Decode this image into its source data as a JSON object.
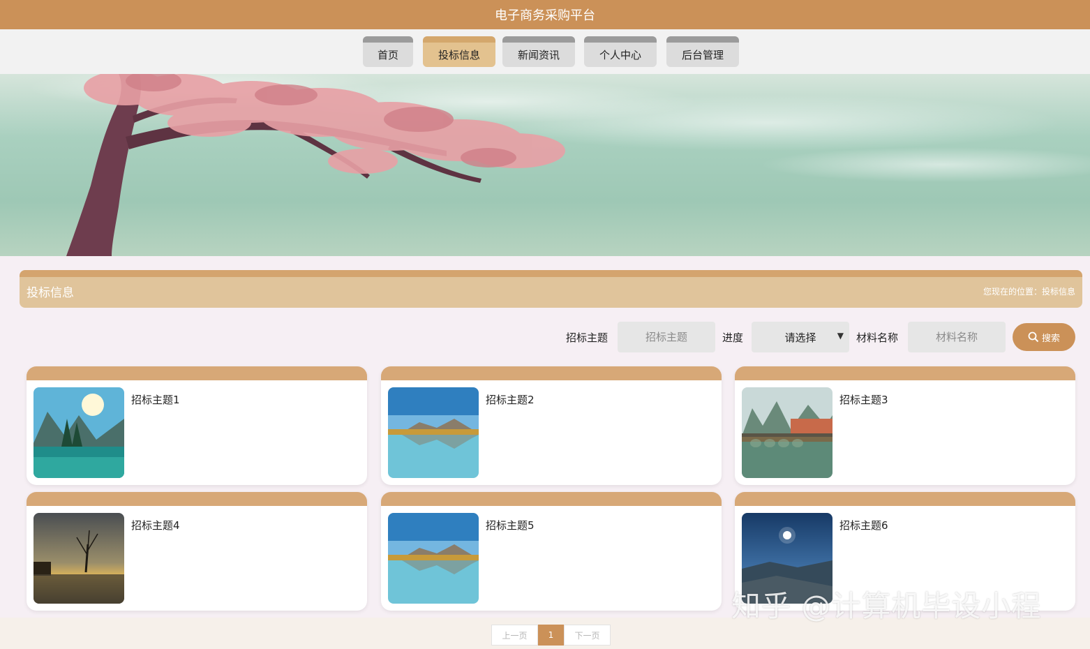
{
  "app": {
    "title": "电子商务采购平台"
  },
  "nav": {
    "items": [
      {
        "label": "首页"
      },
      {
        "label": "投标信息"
      },
      {
        "label": "新闻资讯"
      },
      {
        "label": "个人中心"
      },
      {
        "label": "后台管理"
      }
    ],
    "active_index": 1
  },
  "section": {
    "title": "投标信息",
    "breadcrumb": "您现在的位置：投标信息"
  },
  "search": {
    "topic_label": "招标主题",
    "topic_placeholder": "招标主题",
    "progress_label": "进度",
    "progress_value": "请选择",
    "material_label": "材料名称",
    "material_placeholder": "材料名称",
    "button_label": "搜索"
  },
  "cards": [
    {
      "title": "招标主题1"
    },
    {
      "title": "招标主题2"
    },
    {
      "title": "招标主题3"
    },
    {
      "title": "招标主题4"
    },
    {
      "title": "招标主题5"
    },
    {
      "title": "招标主题6"
    }
  ],
  "pagination": {
    "prev_label": "上一页",
    "current_page": "1",
    "next_label": "下一页"
  },
  "watermark": "知乎 @计算机毕设小程",
  "colors": {
    "brand": "#cb9158",
    "section_header": "#e0c49b",
    "card_header": "#d7a877",
    "active_tab": "#e3c28f"
  }
}
